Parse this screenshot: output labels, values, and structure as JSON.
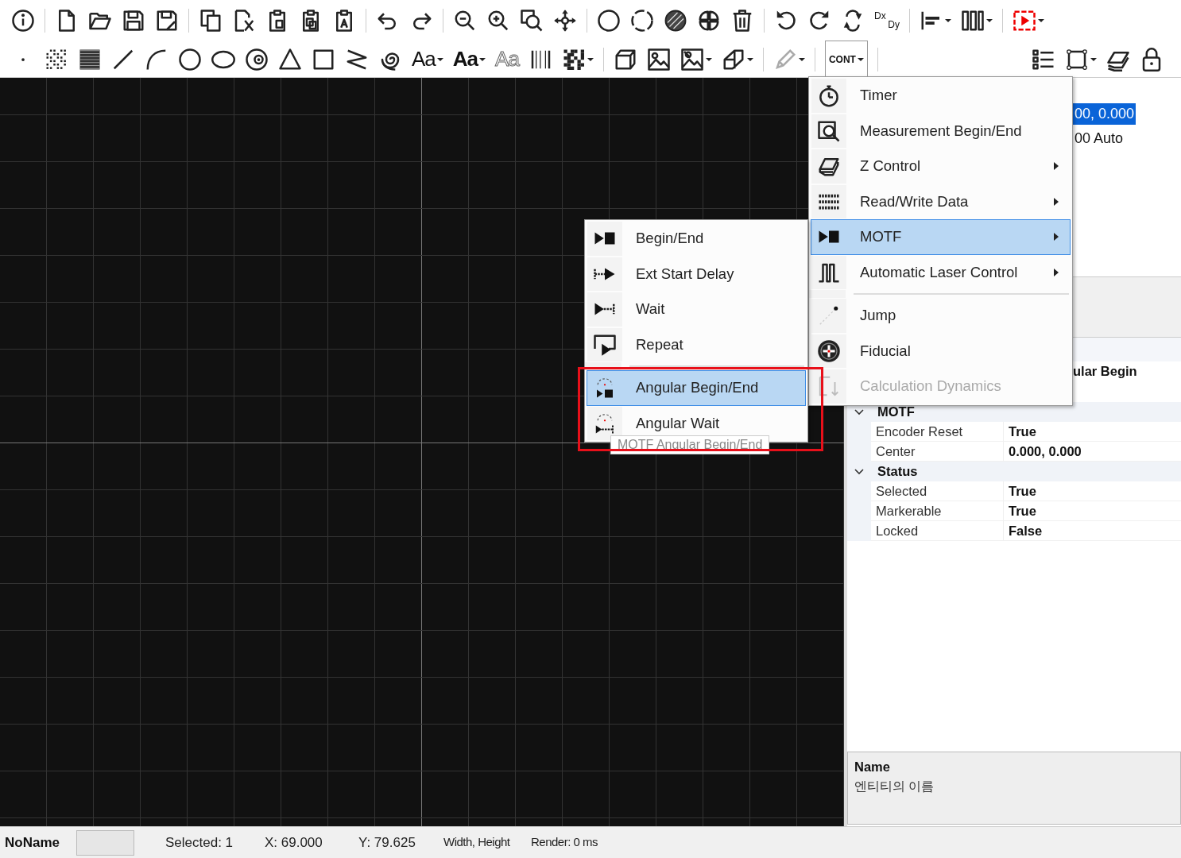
{
  "toolbar": {
    "font_buttons": [
      {
        "label": "Aa",
        "kind": "regular"
      },
      {
        "label": "Aa",
        "kind": "bold"
      },
      {
        "label": "Aa",
        "kind": "outline"
      }
    ],
    "offset_button": {
      "top": "Dx",
      "bottom": "Dy"
    },
    "cont_button": {
      "label": "CONT",
      "expanded": true
    }
  },
  "properties_top": {
    "rows": [
      {
        "value": "00, 0.000",
        "selected": true
      },
      {
        "value": "00 Auto",
        "selected": false
      }
    ]
  },
  "property_grid": {
    "partial_row": {
      "value": "ular Begin"
    },
    "categories": [
      {
        "name": "MOTF",
        "expanded": true,
        "rows": [
          {
            "name": "Encoder Reset",
            "value": "True"
          },
          {
            "name": "Center",
            "value": "0.000, 0.000"
          }
        ]
      },
      {
        "name": "Status",
        "expanded": true,
        "rows": [
          {
            "name": "Selected",
            "value": "True"
          },
          {
            "name": "Markerable",
            "value": "True"
          },
          {
            "name": "Locked",
            "value": "False"
          }
        ]
      }
    ]
  },
  "description": {
    "title": "Name",
    "text": "엔티티의 이름"
  },
  "menu": {
    "items": [
      {
        "kind": "item",
        "label": "Timer",
        "submenu": false,
        "selected": false,
        "disabled": false
      },
      {
        "kind": "item",
        "label": "Measurement Begin/End",
        "submenu": false,
        "selected": false,
        "disabled": false
      },
      {
        "kind": "item",
        "label": "Z Control",
        "submenu": true,
        "selected": false,
        "disabled": false
      },
      {
        "kind": "item",
        "label": "Read/Write Data",
        "submenu": true,
        "selected": false,
        "disabled": false
      },
      {
        "kind": "item",
        "label": "MOTF",
        "submenu": true,
        "selected": true,
        "disabled": false
      },
      {
        "kind": "item",
        "label": "Automatic Laser Control",
        "submenu": true,
        "selected": false,
        "disabled": false
      },
      {
        "kind": "separator"
      },
      {
        "kind": "item",
        "label": "Jump",
        "submenu": false,
        "selected": false,
        "disabled": false
      },
      {
        "kind": "item",
        "label": "Fiducial",
        "submenu": false,
        "selected": false,
        "disabled": false
      },
      {
        "kind": "item",
        "label": "Calculation Dynamics",
        "submenu": false,
        "selected": false,
        "disabled": true
      }
    ]
  },
  "submenu": {
    "items": [
      {
        "kind": "item",
        "label": "Begin/End",
        "selected": false
      },
      {
        "kind": "item",
        "label": "Ext Start Delay",
        "selected": false
      },
      {
        "kind": "item",
        "label": "Wait",
        "selected": false
      },
      {
        "kind": "item",
        "label": "Repeat",
        "selected": false
      },
      {
        "kind": "separator"
      },
      {
        "kind": "item",
        "label": "Angular Begin/End",
        "selected": true
      },
      {
        "kind": "item",
        "label": "Angular Wait",
        "selected": false
      }
    ]
  },
  "tooltip": "MOTF Angular Begin/End",
  "status_bar": {
    "name": "NoName",
    "selected": "Selected: 1",
    "x": "X: 69.000",
    "y": "Y: 79.625",
    "size": "Width, Height",
    "render": "Render: 0 ms"
  }
}
